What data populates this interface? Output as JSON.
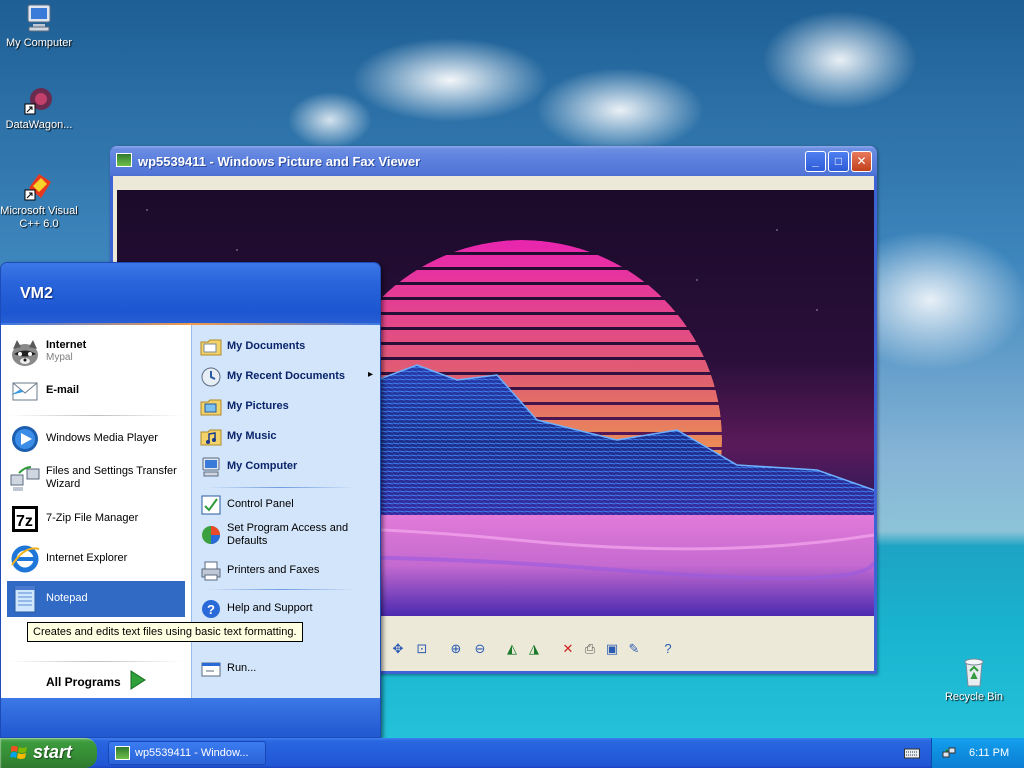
{
  "desktop": {
    "icons": [
      {
        "label": "My Computer"
      },
      {
        "label": "DataWagon..."
      },
      {
        "label": "Microsoft Visual C++ 6.0"
      },
      {
        "label": "Recycle Bin"
      }
    ]
  },
  "viewer": {
    "title": "wp5539411 - Windows Picture and Fax Viewer",
    "minimize_glyph": "_",
    "maximize_glyph": "□",
    "close_glyph": "✕"
  },
  "start_menu": {
    "user": "VM2",
    "pinned": [
      {
        "label": "Internet",
        "sub": "Mypal",
        "icon": "raccoon-browser-icon"
      },
      {
        "label": "E-mail",
        "icon": "email-icon"
      }
    ],
    "recent": [
      {
        "label": "Windows Media Player",
        "icon": "media-player-icon"
      },
      {
        "label": "Files and Settings Transfer Wizard",
        "icon": "transfer-wizard-icon"
      },
      {
        "label": "7-Zip File Manager",
        "icon": "seven-zip-icon"
      },
      {
        "label": "Internet Explorer",
        "icon": "ie-icon"
      },
      {
        "label": "Notepad",
        "icon": "notepad-icon"
      }
    ],
    "all_programs": "All Programs",
    "right": [
      {
        "label": "My Documents",
        "icon": "folder-icon"
      },
      {
        "label": "My Recent Documents",
        "icon": "recent-docs-icon",
        "arrow": "▸"
      },
      {
        "label": "My Pictures",
        "icon": "pictures-folder-icon"
      },
      {
        "label": "My Music",
        "icon": "music-folder-icon"
      },
      {
        "label": "My Computer",
        "icon": "computer-icon"
      },
      {
        "label": "Control Panel",
        "icon": "control-panel-icon"
      },
      {
        "label": "Set Program Access and Defaults",
        "icon": "program-access-icon"
      },
      {
        "label": "Printers and Faxes",
        "icon": "printer-icon"
      },
      {
        "label": "Help and Support",
        "icon": "help-icon"
      },
      {
        "label": "Run...",
        "icon": "run-icon"
      }
    ],
    "tooltip": "Creates and edits text files using basic text formatting."
  },
  "taskbar": {
    "start_label": "start",
    "task_label": "wp5539411 - Window...",
    "clock": "6:11 PM"
  },
  "colors": {
    "selection": "#316ac5",
    "taskbar": "#245edb",
    "start_button": "#358c35"
  }
}
